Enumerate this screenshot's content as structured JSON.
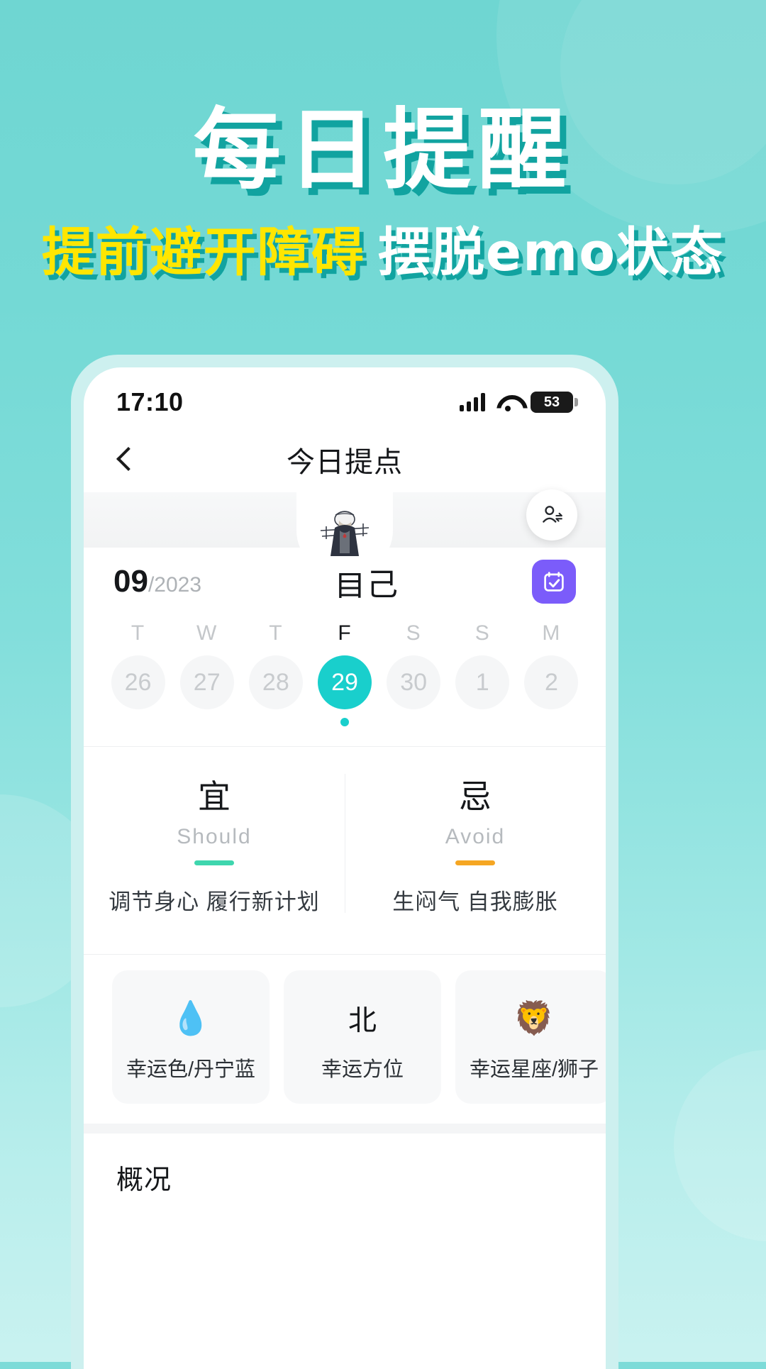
{
  "hero": {
    "title": "每日提醒",
    "subtitle_yellow": "提前避开障碍",
    "subtitle_white": "摆脱emo状态"
  },
  "colors": {
    "background_teal": "#74d9d5",
    "title_shadow": "#11a3a0",
    "yellow": "#ffe600",
    "accent_teal": "#19cfcc",
    "should_bar": "#3fd6ae",
    "avoid_bar": "#f5a623",
    "calendar_button": "#7b5cfa",
    "phone_frame": "#cdf0ef"
  },
  "phone": {
    "status_bar": {
      "time": "17:10",
      "signal_icon": "cellular-signal-icon",
      "wifi_icon": "wifi-icon",
      "battery_icon": "battery-icon",
      "battery_level": "53"
    },
    "navbar": {
      "back_icon": "back-chevron-icon",
      "title": "今日提点"
    },
    "avatar_strip": {
      "avatar_icon": "user-avatar-illustration",
      "person_switch_icon": "person-switch-icon"
    },
    "date_row": {
      "month": "09",
      "year": "/2023",
      "profile_name": "自己",
      "calendar_button_icon": "calendar-check-icon"
    },
    "calendar": {
      "days": [
        {
          "dow": "T",
          "date": "26",
          "active": false,
          "dot": false
        },
        {
          "dow": "W",
          "date": "27",
          "active": false,
          "dot": false
        },
        {
          "dow": "T",
          "date": "28",
          "active": false,
          "dot": false
        },
        {
          "dow": "F",
          "date": "29",
          "active": true,
          "dot": true
        },
        {
          "dow": "S",
          "date": "30",
          "active": false,
          "dot": false
        },
        {
          "dow": "S",
          "date": "1",
          "active": false,
          "dot": false
        },
        {
          "dow": "M",
          "date": "2",
          "active": false,
          "dot": false
        }
      ]
    },
    "should_avoid": [
      {
        "cn": "宜",
        "en": "Should",
        "bar_color": "#3fd6ae",
        "items": "调节身心  履行新计划"
      },
      {
        "cn": "忌",
        "en": "Avoid",
        "bar_color": "#f5a623",
        "items": "生闷气  自我膨胀"
      }
    ],
    "lucky_cards": [
      {
        "icon": "water-drop-icon",
        "glyph": "💧",
        "label": "幸运色/丹宁蓝"
      },
      {
        "icon": "direction-north-icon",
        "glyph": "北",
        "label": "幸运方位"
      },
      {
        "icon": "lion-zodiac-icon",
        "glyph": "🦁",
        "label": "幸运星座/狮子"
      }
    ],
    "overview": {
      "title": "概况"
    }
  }
}
